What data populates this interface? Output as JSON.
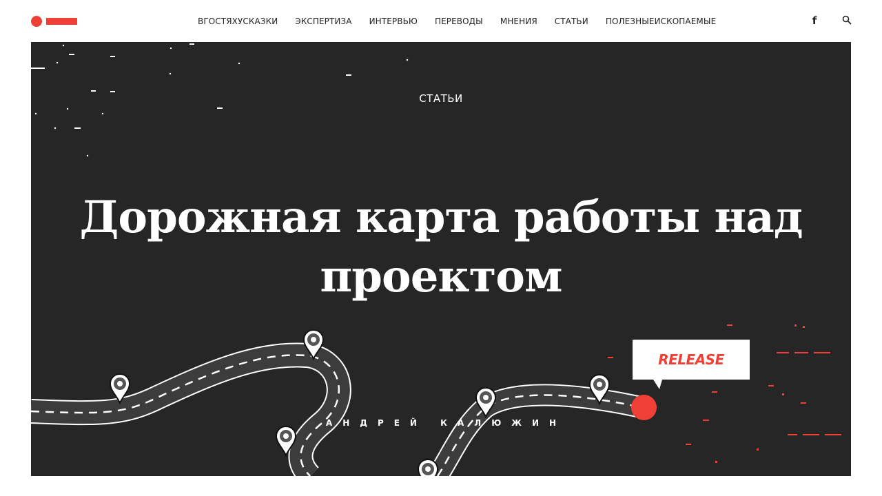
{
  "site": {
    "logo_icon": "logo-dot-bar",
    "brand_color": "#ee4037"
  },
  "nav": {
    "items": [
      {
        "label": "ВГОСТЯХУСКАЗКИ"
      },
      {
        "label": "ЭКСПЕРТИЗА"
      },
      {
        "label": "ИНТЕРВЬЮ"
      },
      {
        "label": "ПЕРЕВОДЫ"
      },
      {
        "label": "МНЕНИЯ"
      },
      {
        "label": "СТАТЬИ"
      },
      {
        "label": "ПОЛЕЗНЫЕИСКОПАЕМЫЕ"
      }
    ]
  },
  "header_icons": {
    "facebook": "f",
    "search_icon": "search-icon"
  },
  "hero": {
    "background_color": "#262626",
    "category": "СТАТЬИ",
    "title": "Дорожная карта работы над проектом",
    "author": "АНДРЕЙ КАЛЮЖИН",
    "release_label": "RELEASE"
  }
}
